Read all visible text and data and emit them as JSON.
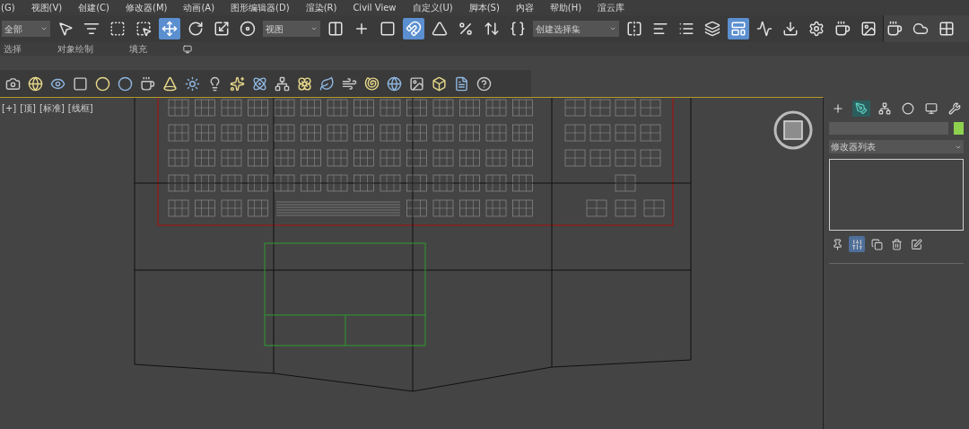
{
  "menu_bar": [
    "(G)",
    "视图(V)",
    "创建(C)",
    "修改器(M)",
    "动画(A)",
    "图形编辑器(D)",
    "渲染(R)",
    "Civil View",
    "自定义(U)",
    "脚本(S)",
    "内容",
    "帮助(H)",
    "渲云库"
  ],
  "main_toolbar": [
    {
      "kind": "dropdown",
      "value": "全部"
    },
    {
      "kind": "button",
      "selected": false
    },
    {
      "kind": "button",
      "selected": false
    },
    {
      "kind": "button",
      "selected": false
    },
    {
      "kind": "button",
      "selected": false
    },
    {
      "kind": "button",
      "selected": true
    },
    {
      "kind": "button",
      "selected": false
    },
    {
      "kind": "button",
      "selected": false
    },
    {
      "kind": "button",
      "selected": false
    },
    {
      "kind": "dropdown",
      "value": "视图"
    },
    {
      "kind": "button",
      "selected": false
    },
    {
      "kind": "button",
      "selected": false
    },
    {
      "kind": "button",
      "selected": false
    },
    {
      "kind": "button",
      "selected": true
    },
    {
      "kind": "button",
      "selected": false
    },
    {
      "kind": "button",
      "selected": false
    },
    {
      "kind": "button",
      "selected": false
    },
    {
      "kind": "button",
      "selected": false
    },
    {
      "kind": "dropdown",
      "value": "创建选择集"
    },
    {
      "kind": "button",
      "selected": false
    },
    {
      "kind": "button",
      "selected": false
    },
    {
      "kind": "button",
      "selected": false
    },
    {
      "kind": "button",
      "selected": false
    },
    {
      "kind": "button",
      "selected": true
    },
    {
      "kind": "button",
      "selected": false
    },
    {
      "kind": "button",
      "selected": false
    },
    {
      "kind": "button",
      "selected": false
    },
    {
      "kind": "button",
      "selected": false
    },
    {
      "kind": "button",
      "selected": false
    },
    {
      "kind": "button",
      "selected": false
    },
    {
      "kind": "button",
      "selected": false
    },
    {
      "kind": "button",
      "selected": false
    }
  ],
  "ribbon_tabs": [
    "选择",
    "对象绘制",
    "填充"
  ],
  "viewport": {
    "labels": [
      "[+]",
      "[顶]",
      "[标准]",
      "[线框]"
    ]
  },
  "command_panel": {
    "tabs": [
      {
        "selected": false
      },
      {
        "selected": true
      },
      {
        "selected": false
      },
      {
        "selected": false
      },
      {
        "selected": false
      },
      {
        "selected": false
      }
    ],
    "modifier_list": "修改器列表",
    "stack_buttons": [
      {
        "selected": false
      },
      {
        "selected": true
      },
      {
        "selected": false
      },
      {
        "selected": false
      },
      {
        "selected": false
      }
    ]
  }
}
